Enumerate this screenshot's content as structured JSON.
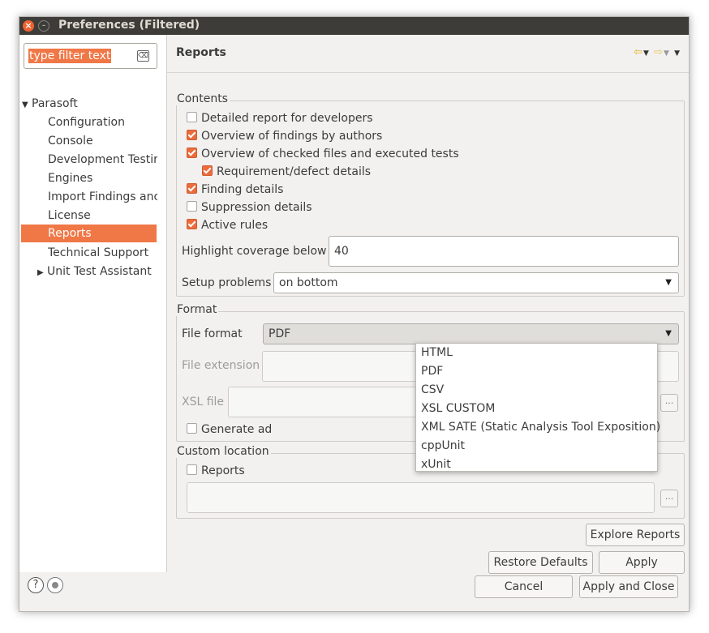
{
  "window": {
    "title": "Preferences (Filtered)"
  },
  "filter": {
    "text": "type filter text"
  },
  "tree": {
    "root": "Parasoft",
    "items": [
      "Configuration",
      "Console",
      "Development Testir",
      "Engines",
      "Import Findings anc",
      "License",
      "Reports",
      "Technical Support"
    ],
    "selected": "Reports",
    "unit_test": "Unit Test Assistant"
  },
  "page": {
    "title": "Reports"
  },
  "contents": {
    "group_label": "Contents",
    "checkboxes": [
      {
        "label": "Detailed report for developers",
        "checked": false
      },
      {
        "label": "Overview of findings by authors",
        "checked": true
      },
      {
        "label": "Overview of checked files and executed tests",
        "checked": true
      },
      {
        "label": "Requirement/defect details",
        "checked": true
      },
      {
        "label": "Finding details",
        "checked": true
      },
      {
        "label": "Suppression details",
        "checked": false
      },
      {
        "label": "Active rules",
        "checked": true
      }
    ],
    "highlight_label": "Highlight coverage below",
    "highlight_value": "40",
    "setup_label": "Setup problems",
    "setup_value": "on bottom"
  },
  "format": {
    "group_label": "Format",
    "file_format_label": "File format",
    "file_format_value": "PDF",
    "file_extension_label": "File extension",
    "xsl_label": "XSL file",
    "generate_label": "Generate ad",
    "dots": "..."
  },
  "dropdown": {
    "options": [
      "HTML",
      "PDF",
      "CSV",
      "XSL CUSTOM",
      "XML SATE (Static Analysis Tool Exposition)",
      "cppUnit",
      "xUnit"
    ]
  },
  "custom_location": {
    "group_label": "Custom location",
    "reports_label": "Reports",
    "dots": "..."
  },
  "buttons": {
    "explore": "Explore Reports",
    "restore": "Restore Defaults",
    "apply": "Apply",
    "cancel": "Cancel",
    "apply_close": "Apply and Close"
  },
  "colors": {
    "accent": "#f07746",
    "titlebar": "#3d3c38",
    "window_bg": "#f2f1f0"
  }
}
